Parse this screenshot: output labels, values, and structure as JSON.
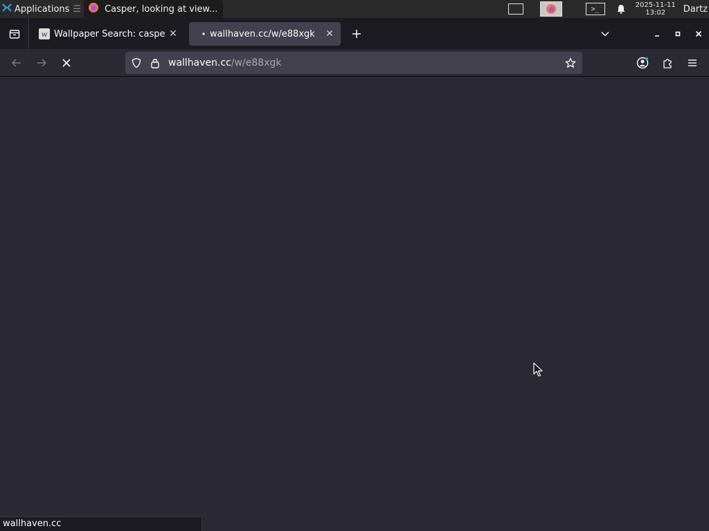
{
  "panel": {
    "applications_label": "Applications",
    "task_title": "Casper, looking at view...",
    "clock_date": "2025-11-11",
    "clock_time": "13:02",
    "user_name": "Dartz"
  },
  "tabs": [
    {
      "title": "Wallpaper Search: casper",
      "active": false,
      "favicon": "wallhaven-favicon"
    },
    {
      "title": "wallhaven.cc/w/e88xgk",
      "active": true,
      "loading": true
    }
  ],
  "urlbar": {
    "host": "wallhaven.cc",
    "path": "/w/e88xgk"
  },
  "status": {
    "text": "wallhaven.cc"
  },
  "colors": {
    "toolbar": "#2b2a33",
    "tabstrip": "#1c1b22",
    "active_tab": "#42414d",
    "urlbar": "#42414d",
    "system_panel": "#2a2a2a"
  }
}
